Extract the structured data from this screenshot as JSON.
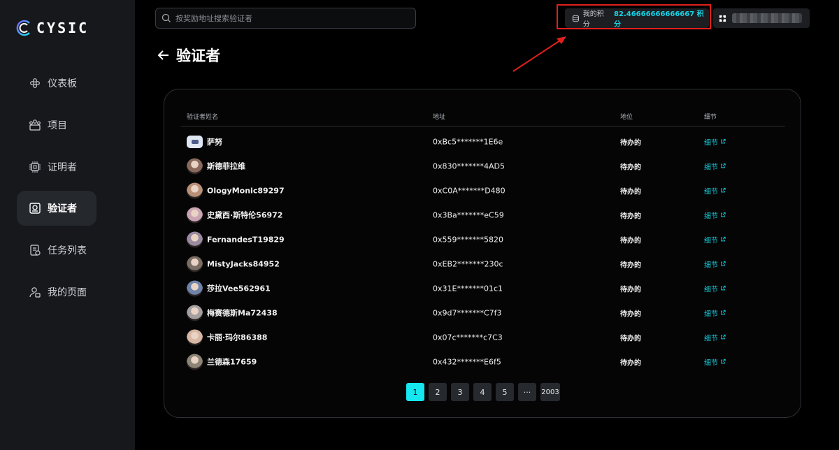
{
  "brand": {
    "name": "CYSIC"
  },
  "sidebar": {
    "items": [
      {
        "label": "仪表板",
        "icon": "dashboard-icon",
        "active": false
      },
      {
        "label": "项目",
        "icon": "projects-icon",
        "active": false
      },
      {
        "label": "证明者",
        "icon": "chip-icon",
        "active": false
      },
      {
        "label": "验证者",
        "icon": "verifier-icon",
        "active": true
      },
      {
        "label": "任务列表",
        "icon": "task-list-icon",
        "active": false
      },
      {
        "label": "我的页面",
        "icon": "user-icon",
        "active": false
      }
    ]
  },
  "search": {
    "placeholder": "按奖励地址搜索验证者"
  },
  "points": {
    "label": "我的积分",
    "value": "82.46666666666667 积分",
    "icon": "coin-stack-icon"
  },
  "wallet": {
    "icon": "wallet-icon"
  },
  "page": {
    "title": "验证者"
  },
  "table": {
    "headers": {
      "name": "验证者姓名",
      "address": "地址",
      "status": "地位",
      "detail": "细节"
    },
    "rows": [
      {
        "name": "萨努",
        "address": "0xBc5*******1E6e",
        "status": "待办的",
        "detail": "细节",
        "avatar_color": "#dfe7f3"
      },
      {
        "name": "斯德菲拉维",
        "address": "0x830*******4AD5",
        "status": "待办的",
        "detail": "细节",
        "avatar_color": "#8a6a5c"
      },
      {
        "name": "OlogyMonic89297",
        "address": "0xC0A*******D480",
        "status": "待办的",
        "detail": "细节",
        "avatar_color": "#b89078"
      },
      {
        "name": "史黛西·斯特伦56972",
        "address": "0x3Ba*******eC59",
        "status": "待办的",
        "detail": "细节",
        "avatar_color": "#c9a4b2"
      },
      {
        "name": "FernandesT19829",
        "address": "0x559*******5820",
        "status": "待办的",
        "detail": "细节",
        "avatar_color": "#9a8aa0"
      },
      {
        "name": "MistyJacks84952",
        "address": "0xEB2*******230c",
        "status": "待办的",
        "detail": "细节",
        "avatar_color": "#7a6d63"
      },
      {
        "name": "莎拉Vee562961",
        "address": "0x31E*******01c1",
        "status": "待办的",
        "detail": "细节",
        "avatar_color": "#6f83a8"
      },
      {
        "name": "梅赛德斯Ma72438",
        "address": "0x9d7*******C7f3",
        "status": "待办的",
        "detail": "细节",
        "avatar_color": "#a5a0a0"
      },
      {
        "name": "卡丽·玛尔86388",
        "address": "0x07c*******c7C3",
        "status": "待办的",
        "detail": "细节",
        "avatar_color": "#d7b7a4"
      },
      {
        "name": "兰德森17659",
        "address": "0x432*******E6f5",
        "status": "待办的",
        "detail": "细节",
        "avatar_color": "#8c8476"
      }
    ]
  },
  "pagination": {
    "pages": [
      "1",
      "2",
      "3",
      "4",
      "5",
      "···",
      "2003"
    ],
    "current": "1"
  },
  "colors": {
    "accent": "#16e6f0",
    "annotation": "#e0201c",
    "link": "#17c6d6"
  }
}
